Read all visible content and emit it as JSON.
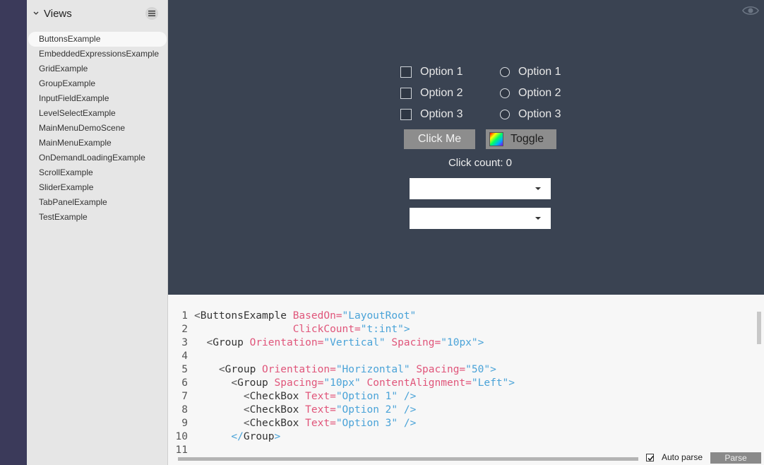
{
  "sidebar": {
    "title": "Views",
    "items": [
      "ButtonsExample",
      "EmbeddedExpressionsExample",
      "GridExample",
      "GroupExample",
      "InputFieldExample",
      "LevelSelectExample",
      "MainMenuDemoScene",
      "MainMenuExample",
      "OnDemandLoadingExample",
      "ScrollExample",
      "SliderExample",
      "TabPanelExample",
      "TestExample"
    ],
    "selected_index": 0
  },
  "preview": {
    "checkboxes": [
      "Option 1",
      "Option 2",
      "Option 3"
    ],
    "radios": [
      "Option 1",
      "Option 2",
      "Option 3"
    ],
    "click_button": "Click Me",
    "toggle_button": "Toggle",
    "click_count": "Click count: 0",
    "dropdown1_value": "",
    "dropdown2_value": ""
  },
  "editor": {
    "lines": [
      {
        "n": "1",
        "tokens": [
          [
            "br",
            "<"
          ],
          [
            "tag",
            "ButtonsExample"
          ],
          [
            "sp",
            " "
          ],
          [
            "attr",
            "BasedOn"
          ],
          [
            "attr",
            "="
          ],
          [
            "val",
            "\"LayoutRoot\""
          ]
        ]
      },
      {
        "n": "2",
        "tokens": [
          [
            "sp",
            "                "
          ],
          [
            "attr",
            "ClickCount"
          ],
          [
            "attr",
            "="
          ],
          [
            "val",
            "\"t:int\""
          ],
          [
            "val",
            ">"
          ]
        ]
      },
      {
        "n": "3",
        "tokens": [
          [
            "sp",
            "  "
          ],
          [
            "br",
            "<"
          ],
          [
            "tag",
            "Group"
          ],
          [
            "sp",
            " "
          ],
          [
            "attr",
            "Orientation"
          ],
          [
            "attr",
            "="
          ],
          [
            "val",
            "\"Vertical\""
          ],
          [
            "sp",
            " "
          ],
          [
            "attr",
            "Spacing"
          ],
          [
            "attr",
            "="
          ],
          [
            "val",
            "\"10px\""
          ],
          [
            "val",
            ">"
          ]
        ]
      },
      {
        "n": "4",
        "tokens": []
      },
      {
        "n": "5",
        "tokens": [
          [
            "sp",
            "    "
          ],
          [
            "br",
            "<"
          ],
          [
            "tag",
            "Group"
          ],
          [
            "sp",
            " "
          ],
          [
            "attr",
            "Orientation"
          ],
          [
            "attr",
            "="
          ],
          [
            "val",
            "\"Horizontal\""
          ],
          [
            "sp",
            " "
          ],
          [
            "attr",
            "Spacing"
          ],
          [
            "attr",
            "="
          ],
          [
            "val",
            "\"50\""
          ],
          [
            "val",
            ">"
          ]
        ]
      },
      {
        "n": "6",
        "tokens": [
          [
            "sp",
            "      "
          ],
          [
            "br",
            "<"
          ],
          [
            "tag",
            "Group"
          ],
          [
            "sp",
            " "
          ],
          [
            "attr",
            "Spacing"
          ],
          [
            "attr",
            "="
          ],
          [
            "val",
            "\"10px\""
          ],
          [
            "sp",
            " "
          ],
          [
            "attr",
            "ContentAlignment"
          ],
          [
            "attr",
            "="
          ],
          [
            "val",
            "\"Left\""
          ],
          [
            "val",
            ">"
          ]
        ]
      },
      {
        "n": "7",
        "tokens": [
          [
            "sp",
            "        "
          ],
          [
            "br",
            "<"
          ],
          [
            "tag",
            "CheckBox"
          ],
          [
            "sp",
            " "
          ],
          [
            "attr",
            "Text"
          ],
          [
            "attr",
            "="
          ],
          [
            "val",
            "\"Option 1\""
          ],
          [
            "sp",
            " "
          ],
          [
            "val",
            "/>"
          ]
        ]
      },
      {
        "n": "8",
        "tokens": [
          [
            "sp",
            "        "
          ],
          [
            "br",
            "<"
          ],
          [
            "tag",
            "CheckBox"
          ],
          [
            "sp",
            " "
          ],
          [
            "attr",
            "Text"
          ],
          [
            "attr",
            "="
          ],
          [
            "val",
            "\"Option 2\""
          ],
          [
            "sp",
            " "
          ],
          [
            "val",
            "/>"
          ]
        ]
      },
      {
        "n": "9",
        "tokens": [
          [
            "sp",
            "        "
          ],
          [
            "br",
            "<"
          ],
          [
            "tag",
            "CheckBox"
          ],
          [
            "sp",
            " "
          ],
          [
            "attr",
            "Text"
          ],
          [
            "attr",
            "="
          ],
          [
            "val",
            "\"Option 3\""
          ],
          [
            "sp",
            " "
          ],
          [
            "val",
            "/>"
          ]
        ]
      },
      {
        "n": "10",
        "tokens": [
          [
            "sp",
            "      "
          ],
          [
            "val",
            "</"
          ],
          [
            "tag",
            "Group"
          ],
          [
            "val",
            ">"
          ]
        ]
      },
      {
        "n": "11",
        "tokens": []
      }
    ],
    "auto_parse_label": "Auto parse",
    "auto_parse_checked": true,
    "parse_button": "Parse"
  }
}
